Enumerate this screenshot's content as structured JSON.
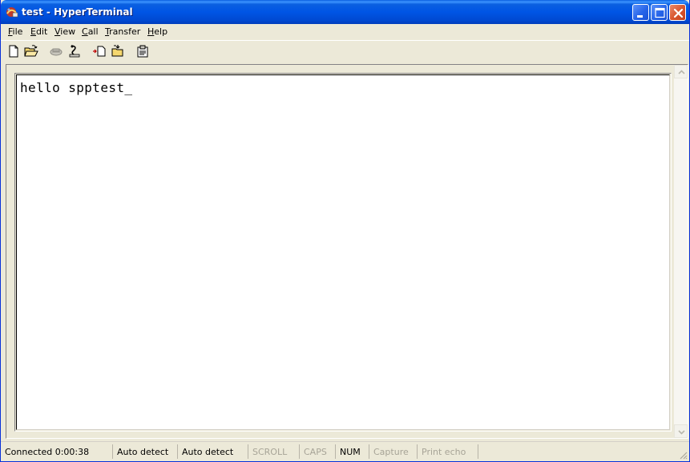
{
  "window": {
    "title": "test - HyperTerminal",
    "icon": "hyperterminal-app-icon"
  },
  "caption_buttons": [
    "minimize",
    "maximize",
    "close"
  ],
  "menu": [
    {
      "label": "File",
      "underline": "F",
      "rest": "ile"
    },
    {
      "label": "Edit",
      "underline": "E",
      "rest": "dit"
    },
    {
      "label": "View",
      "underline": "V",
      "rest": "iew"
    },
    {
      "label": "Call",
      "underline": "C",
      "rest": "all"
    },
    {
      "label": "Transfer",
      "underline": "T",
      "rest": "ransfer"
    },
    {
      "label": "Help",
      "underline": "H",
      "rest": "elp"
    }
  ],
  "toolbar": [
    {
      "icon": "new-document-icon"
    },
    {
      "icon": "open-folder-icon"
    },
    {
      "icon": "phone-call-icon"
    },
    {
      "icon": "disconnect-icon"
    },
    {
      "icon": "send-file-icon"
    },
    {
      "icon": "receive-file-icon"
    },
    {
      "icon": "properties-icon"
    }
  ],
  "terminal": {
    "text": "hello spptest_"
  },
  "status": {
    "connected": "Connected 0:00:38",
    "emulation": "Auto detect",
    "settings": "Auto detect",
    "scroll": "SCROLL",
    "caps": "CAPS",
    "num": "NUM",
    "capture": "Capture",
    "print_echo": "Print echo"
  },
  "colors": {
    "titlebar": "#0055e5",
    "window_bg": "#ece9d8",
    "terminal_bg": "#ffffff",
    "close_button": "#d8542d",
    "status_dim": "#a7a497"
  }
}
